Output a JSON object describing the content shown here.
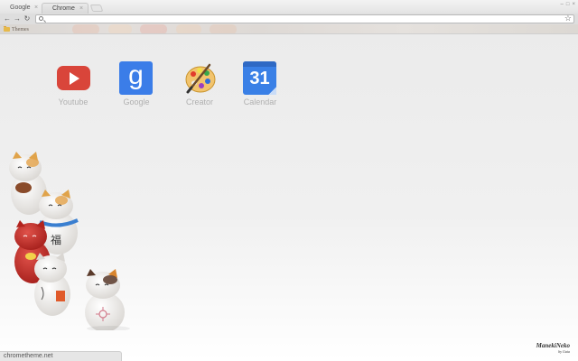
{
  "tabs": [
    {
      "label": "Google",
      "close": "×"
    },
    {
      "label": "Chrome",
      "close": "×"
    }
  ],
  "window_controls": [
    "–",
    "□",
    "×"
  ],
  "toolbar": {
    "back": "←",
    "forward": "→",
    "reload": "↻",
    "omnibox_value": "",
    "star": "☆"
  },
  "bookmarks": [
    {
      "label": "Themes",
      "icon": "folder-icon"
    }
  ],
  "apps": [
    {
      "label": "Youtube",
      "icon": "youtube-icon"
    },
    {
      "label": "Google",
      "icon": "google-icon",
      "glyph": "g"
    },
    {
      "label": "Creator",
      "icon": "palette-icon"
    },
    {
      "label": "Calendar",
      "icon": "calendar-icon",
      "glyph": "31"
    }
  ],
  "watermark": {
    "main": "ManekiNeko",
    "sub": "by Gaia"
  },
  "status": "chrometheme.net",
  "colors": {
    "youtube": "#d9453a",
    "google": "#3b7de8",
    "calendar": "#3a80e6",
    "label_gray": "#b0b0b0"
  }
}
